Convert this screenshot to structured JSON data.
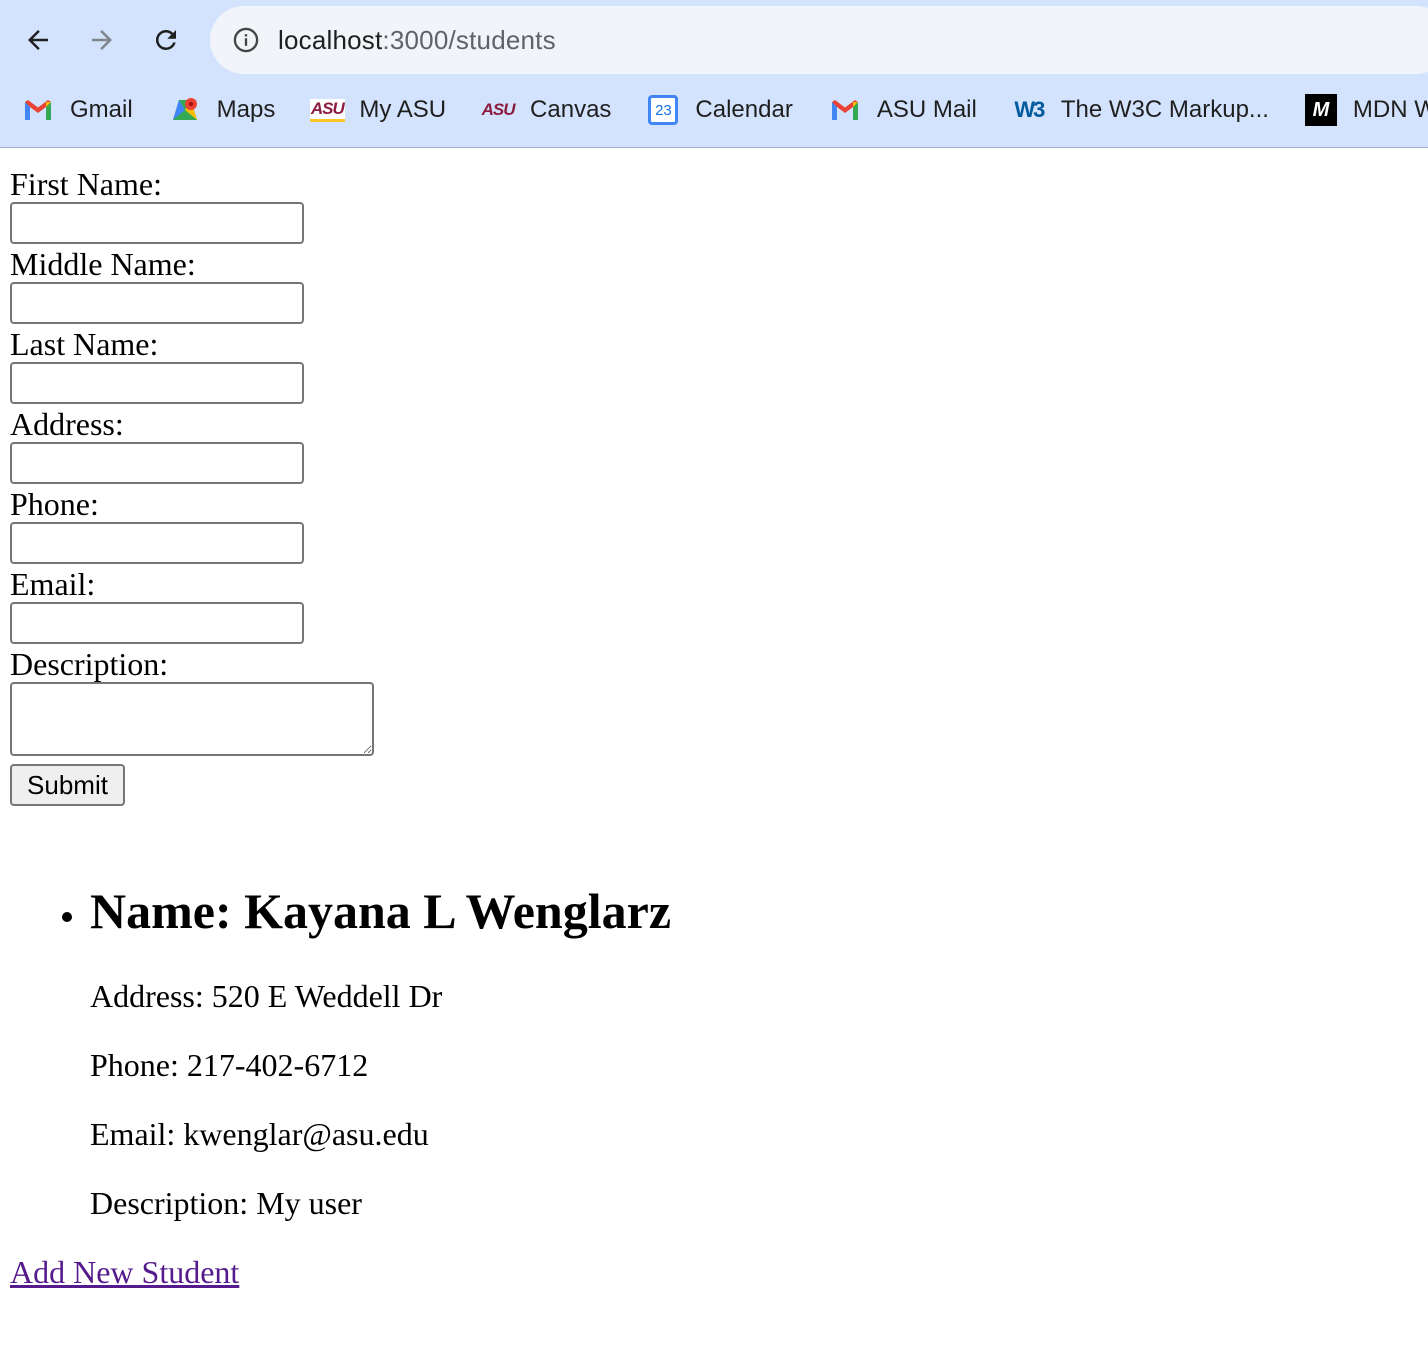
{
  "browser": {
    "url_host": "localhost",
    "url_path": ":3000/students",
    "bookmarks": [
      {
        "label": "Gmail",
        "icon": "gmail-icon"
      },
      {
        "label": "Maps",
        "icon": "maps-icon"
      },
      {
        "label": "My ASU",
        "icon": "asu-icon"
      },
      {
        "label": "Canvas",
        "icon": "asu-canvas-icon"
      },
      {
        "label": "Calendar",
        "icon": "calendar-icon"
      },
      {
        "label": "ASU Mail",
        "icon": "gmail-icon"
      },
      {
        "label": "The W3C Markup...",
        "icon": "w3c-icon"
      },
      {
        "label": "MDN W",
        "icon": "mdn-icon"
      }
    ],
    "calendar_day": "23"
  },
  "form": {
    "first_name_label": "First Name:",
    "middle_name_label": "Middle Name:",
    "last_name_label": "Last Name:",
    "address_label": "Address:",
    "phone_label": "Phone:",
    "email_label": "Email:",
    "description_label": "Description:",
    "submit_label": "Submit"
  },
  "students": [
    {
      "name": "Name: Kayana L Wenglarz",
      "address": "Address: 520 E Weddell Dr",
      "phone": "Phone: 217-402-6712",
      "email": "Email: kwenglar@asu.edu",
      "description": "Description: My user"
    }
  ],
  "add_link": "Add New Student",
  "colors": {
    "chrome_bg": "#d3e3fd",
    "omnibox_bg": "#f1f4f9",
    "visited_link": "#551a8b"
  }
}
